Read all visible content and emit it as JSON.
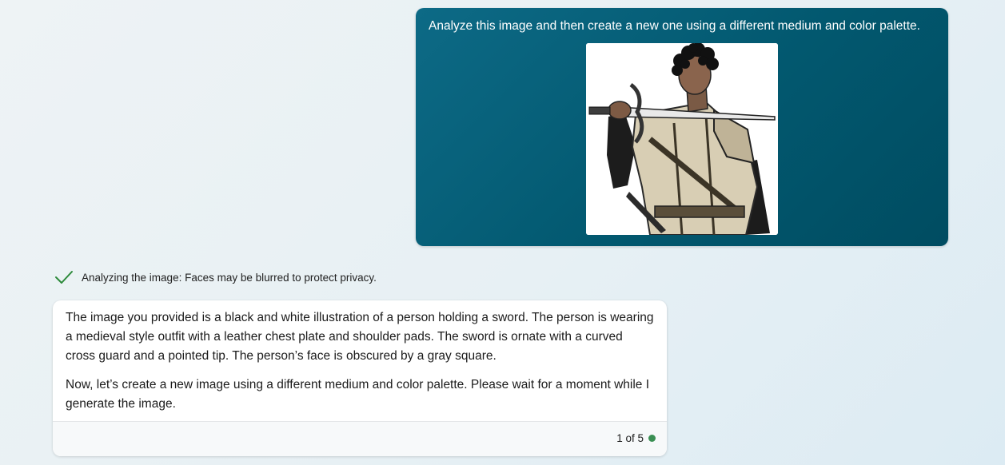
{
  "user_message": {
    "text": "Analyze this image and then create a new one using a different medium and color palette.",
    "attachment_icon": "illustration-thumbnail"
  },
  "status": {
    "icon": "check-icon",
    "text": "Analyzing the image: Faces may be blurred to protect privacy."
  },
  "assistant_message": {
    "paragraphs": [
      "The image you provided is a black and white illustration of a person holding a sword. The person is wearing a medieval style outfit with a leather chest plate and shoulder pads. The sword is ornate with a curved cross guard and a pointed tip. The person’s face is obscured by a gray square.",
      "Now, let’s create a new image using a different medium and color palette. Please wait for a moment while I generate the image."
    ],
    "turn_counter": "1 of 5"
  },
  "colors": {
    "user_bubble": "#02586f",
    "check_green": "#2c8a3a",
    "status_dot": "#3a8f53"
  }
}
